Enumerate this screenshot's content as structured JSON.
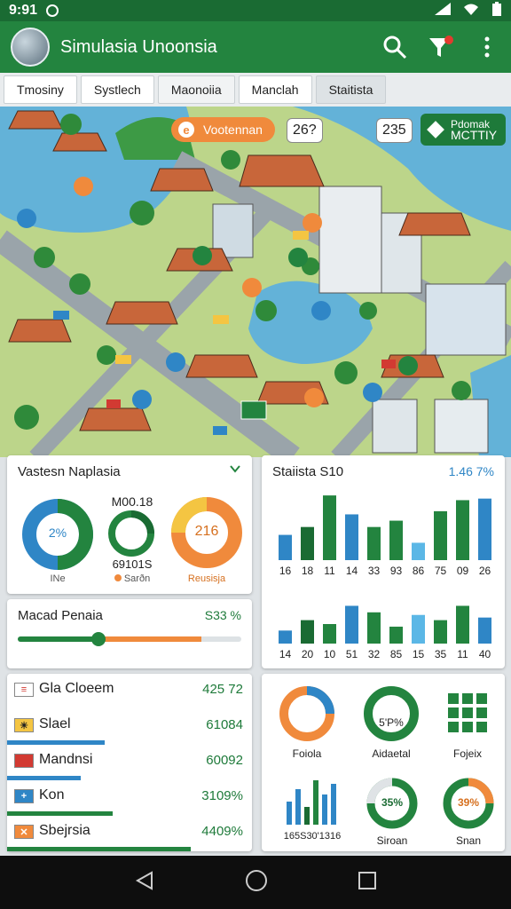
{
  "status": {
    "time": "9:91"
  },
  "app": {
    "title": "Simulasia Unoonsia"
  },
  "tabs": [
    {
      "label": "Tmosiny"
    },
    {
      "label": "Systlech"
    },
    {
      "label": "Maonoiia"
    },
    {
      "label": "Manclah"
    },
    {
      "label": "Staitista"
    }
  ],
  "map": {
    "chip_label": "Vootennan",
    "chip_count_a": "26?",
    "chip_count_b": "235",
    "chip_green_line1": "Pdomak",
    "chip_green_line2": "MCTTIY"
  },
  "card_overview": {
    "title": "Vastesn Naplasia",
    "donut1_value": "2%",
    "donut1_label": "INe",
    "donut2_top": "M00.18",
    "donut2_bottom": "69101S",
    "donut2_legend": "Sarðn",
    "donut3_value": "216",
    "donut3_label": "Reusisja"
  },
  "card_progress": {
    "title": "Macad Penaia",
    "value": "S33 %",
    "progress": 0.36
  },
  "card_list": {
    "rows": [
      {
        "name": "Gla Cloeem",
        "value": "425 72",
        "bar": 0.0
      },
      {
        "name": "Slael",
        "value": "61084",
        "bar": 0.4
      },
      {
        "name": "Mandnsi",
        "value": "60092",
        "bar": 0.3
      },
      {
        "name": "Kon",
        "value": "3109%",
        "bar": 0.43
      },
      {
        "name": "Sbejrsia",
        "value": "4409%",
        "bar": 0.75
      }
    ]
  },
  "card_stats": {
    "title": "Staiista S10",
    "value": "1.46 7%",
    "chart_top_labels": [
      "16",
      "18",
      "11",
      "14",
      "33",
      "93",
      "86",
      "75",
      "09",
      "26"
    ],
    "chart_bottom_labels": [
      "14",
      "20",
      "10",
      "51",
      "32",
      "85",
      "15",
      "35",
      "11",
      "40"
    ]
  },
  "card_icons": {
    "items": [
      {
        "label": "Foiola"
      },
      {
        "label": "Aidaetal",
        "value": "5'P%"
      },
      {
        "label": "Fojeix"
      },
      {
        "label": "165S30'1316"
      },
      {
        "label": "Siroan",
        "value": "35%"
      },
      {
        "label": "Snan",
        "value": "39%"
      }
    ]
  },
  "colors": {
    "green": "#23843f",
    "dark_green": "#1a6b33",
    "blue": "#2f86c6",
    "orange": "#f08a3c"
  },
  "chart_data": [
    {
      "type": "bar",
      "categories": [
        "16",
        "18",
        "11",
        "14",
        "33",
        "93",
        "86",
        "75",
        "09",
        "26"
      ],
      "values": [
        32,
        42,
        82,
        58,
        42,
        50,
        22,
        62,
        76,
        78
      ]
    },
    {
      "type": "bar",
      "categories": [
        "14",
        "20",
        "10",
        "51",
        "32",
        "85",
        "15",
        "35",
        "11",
        "40"
      ],
      "values": [
        20,
        36,
        30,
        58,
        48,
        26,
        44,
        36,
        58,
        40
      ]
    }
  ]
}
